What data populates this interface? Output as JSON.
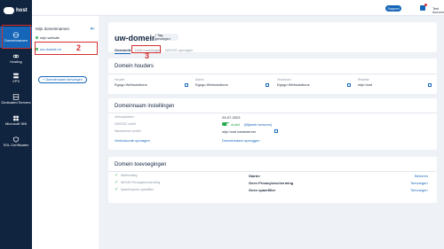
{
  "brand": {
    "logo_text": "host"
  },
  "leftnav": [
    {
      "label": "Domeinnamen",
      "icon": "globe-icon",
      "active": true
    },
    {
      "label": "Hosting",
      "icon": "link-icon",
      "active": false
    },
    {
      "label": "VPS",
      "icon": "server-icon",
      "active": false
    },
    {
      "label": "Dedicated Servers",
      "icon": "rack-icon",
      "active": false
    },
    {
      "label": "Microsoft 365",
      "icon": "windows-icon",
      "active": false
    },
    {
      "label": "SSL Certificaten",
      "icon": "shield-icon",
      "active": false
    }
  ],
  "sidebar": {
    "heading": "Mijn domeinnamen",
    "items": [
      {
        "label": "mijn.website"
      },
      {
        "label": "uw-domein.nl"
      }
    ],
    "add_label": "+ Domeinnaam toevoegen"
  },
  "topbar": {
    "support": "Support",
    "account": "Test Account",
    "avatar_initials": "TA"
  },
  "domain": {
    "title": "uw-domein.nl",
    "tag_button": "+ Tag toevoegen",
    "tabs": [
      "Overzicht",
      "DNS instellingen",
      "WHOIS opvragen"
    ]
  },
  "holders": {
    "title": "Domein houders",
    "items": [
      {
        "label": "Houder",
        "value": "Egogo Websolutions"
      },
      {
        "label": "Admin",
        "value": "Egogo Websolutions"
      },
      {
        "label": "Technisch",
        "value": "Egogo Websolutions"
      },
      {
        "label": "Reseller",
        "value": "mijn.host"
      }
    ]
  },
  "settings": {
    "title": "Domeinnaam instellingen",
    "rows": [
      {
        "label": "Verloopdatum",
        "value": "29-07-2023",
        "extra": ""
      },
      {
        "label": "DNSSEC actief",
        "value": "Actief",
        "extra": "(Bijwerk behoren)"
      },
      {
        "label": "Nameserver profiel",
        "value": "mijn.host nameserver",
        "extra": ""
      }
    ],
    "links": [
      "Verhuiscode opvragen",
      "Domeinnaam opzeggen"
    ]
  },
  "additions": {
    "title": "Domein toevoegingen",
    "rows": [
      {
        "label": "Webhosting",
        "value": "Starter",
        "action": "Beheren"
      },
      {
        "label": "WHOIS Privacybescherming",
        "value": "Geen Privacybescherming",
        "action": "Toevoegen"
      },
      {
        "label": "SpamExperts spamfilter",
        "value": "Geen spamfilter",
        "action": "Toevoegen"
      }
    ]
  },
  "annotations": [
    "2",
    "3"
  ],
  "colors": {
    "nav_bg": "#10233f",
    "accent": "#1566b8",
    "highlight": "#d32f2f",
    "success": "#27a84a"
  }
}
